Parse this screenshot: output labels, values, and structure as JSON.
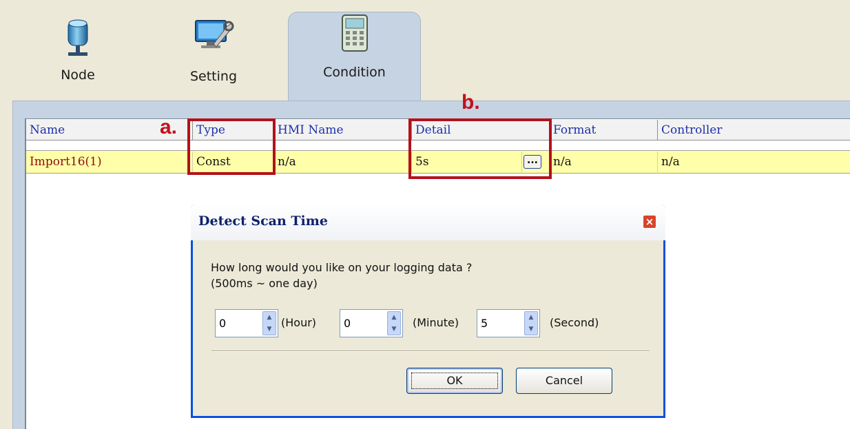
{
  "tabs": [
    {
      "label": "Node",
      "icon": "network-node-icon"
    },
    {
      "label": "Setting",
      "icon": "monitor-wrench-icon"
    },
    {
      "label": "Condition",
      "icon": "calculator-icon",
      "active": true
    }
  ],
  "table": {
    "columns": [
      "Name",
      "Type",
      "HMI Name",
      "Detail",
      "Format",
      "Controller"
    ],
    "rows": [
      [
        "Import16(1)",
        "Const",
        "n/a",
        "5s",
        "n/a",
        "n/a"
      ]
    ]
  },
  "callouts": {
    "a": {
      "letter": "a.",
      "target": "Type"
    },
    "b": {
      "letter": "b.",
      "target": "Detail"
    }
  },
  "detail_button_label": "...",
  "dialog": {
    "title": "Detect Scan Time",
    "close_label": "×",
    "prompt_line1": "How long would you like on your logging data ?",
    "prompt_line2": "(500ms ~  one day)",
    "hour": {
      "value": "0",
      "unit": "(Hour)"
    },
    "minute": {
      "value": "0",
      "unit": "(Minute)"
    },
    "second": {
      "value": "5",
      "unit": "(Second)"
    },
    "ok_label": "OK",
    "cancel_label": "Cancel"
  },
  "colors": {
    "accent_red": "#b3111a",
    "header_text": "#1c2fa8",
    "row_highlight": "#ffffaa",
    "dialog_frame": "#0a4fe0"
  }
}
